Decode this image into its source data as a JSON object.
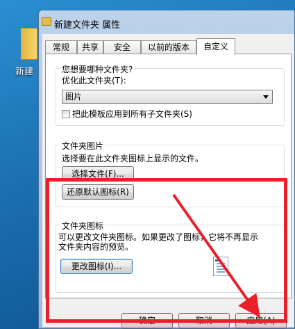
{
  "desktop": {
    "icon_label": "新建"
  },
  "window": {
    "title": "新建文件夹 属性"
  },
  "tabs": [
    {
      "label": "常规",
      "active": false
    },
    {
      "label": "共享",
      "active": false
    },
    {
      "label": "安全",
      "active": false
    },
    {
      "label": "以前的版本",
      "active": false
    },
    {
      "label": "自定义",
      "active": true
    }
  ],
  "folder_type": {
    "title": "您想要哪种文件夹?",
    "optimize_label": "优化此文件夹(T):",
    "selected_option": "图片",
    "apply_all_label": "把此模板应用到所有子文件夹(S)"
  },
  "folder_picture": {
    "title": "文件夹图片",
    "description": "选择要在此文件夹图标上显示的文件。",
    "choose_button": "选择文件(F)...",
    "restore_button": "还原默认图标(R)"
  },
  "folder_icon": {
    "title": "文件夹图标",
    "description_line1": "可以更改文件夹图标。如果更改了图标，它将不再显示",
    "description_line2": "文件夹内容的预览。",
    "change_button": "更改图标(I)...",
    "preview_icon": "text-document-icon"
  },
  "footer": {
    "ok_button": "确定",
    "cancel_button": "取消",
    "apply_button": "应用(A)"
  },
  "annotation": {
    "color": "#e8202a"
  }
}
